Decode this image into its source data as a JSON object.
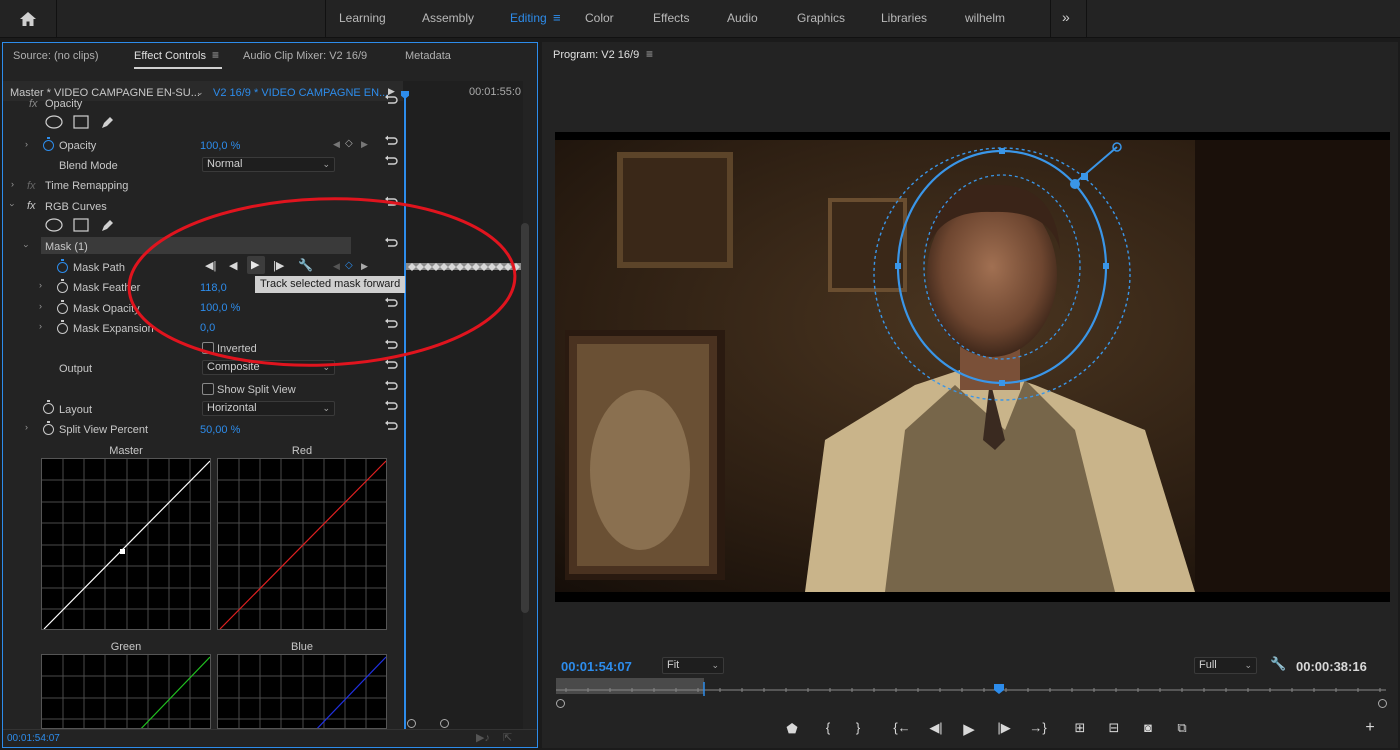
{
  "workspaces": {
    "tabs": [
      "Learning",
      "Assembly",
      "Editing",
      "Color",
      "Effects",
      "Audio",
      "Graphics",
      "Libraries",
      "wilhelm"
    ],
    "active": "Editing"
  },
  "left_panel": {
    "tabs": {
      "source": "Source: (no clips)",
      "effect_controls": "Effect Controls",
      "audio_mixer": "Audio Clip Mixer: V2 16/9",
      "metadata": "Metadata"
    },
    "master_clip": "Master * VIDEO CAMPAGNE EN-SU...",
    "sequence_clip": "V2 16/9 * VIDEO CAMPAGNE EN...",
    "timeline_time": "00:01:55:0",
    "rows": {
      "opacity_header": "Opacity",
      "opacity_label": "Opacity",
      "opacity_value": "100,0 %",
      "blend_mode_label": "Blend Mode",
      "blend_mode_value": "Normal",
      "time_remapping": "Time Remapping",
      "rgb_curves": "RGB Curves",
      "mask": "Mask (1)",
      "mask_path": "Mask Path",
      "mask_feather": "Mask Feather",
      "mask_feather_value": "118,0",
      "mask_opacity": "Mask Opacity",
      "mask_opacity_value": "100,0 %",
      "mask_expansion": "Mask Expansion",
      "mask_expansion_value": "0,0",
      "inverted": "Inverted",
      "output_label": "Output",
      "output_value": "Composite",
      "show_split_view": "Show Split View",
      "layout_label": "Layout",
      "layout_value": "Horizontal",
      "split_view_label": "Split View Percent",
      "split_view_value": "50,00 %"
    },
    "tooltip": "Track selected mask forward",
    "curves": {
      "master": "Master",
      "red": "Red",
      "green": "Green",
      "blue": "Blue"
    },
    "footer_time": "00:01:54:07"
  },
  "program": {
    "title": "Program: V2 16/9",
    "timecode": "00:01:54:07",
    "fit": "Fit",
    "quality": "Full",
    "duration": "00:00:38:16"
  },
  "colors": {
    "accent": "#2d8ceb",
    "annotation": "#e0141e"
  }
}
